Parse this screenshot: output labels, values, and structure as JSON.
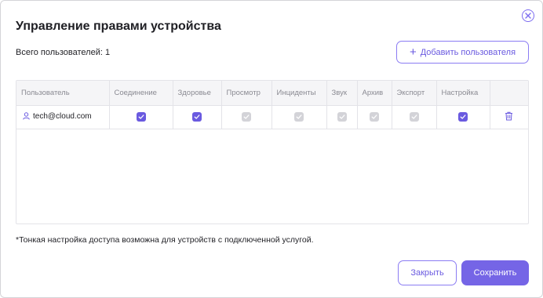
{
  "dialog": {
    "title": "Управление правами устройства",
    "total_users": "Всего пользователей: 1",
    "add_user_label": "Добавить пользователя",
    "footnote": "*Тонкая настройка доступа возможна для устройств с подключенной услугой.",
    "close_label": "Закрыть",
    "save_label": "Сохранить"
  },
  "table": {
    "headers": [
      "Пользователь",
      "Соединение",
      "Здоровье",
      "Просмотр",
      "Инциденты",
      "Звук",
      "Архив",
      "Экспорт",
      "Настройка"
    ],
    "rows": [
      {
        "user": "tech@cloud.com",
        "permissions": [
          true,
          true,
          false,
          false,
          false,
          false,
          false,
          true
        ]
      }
    ]
  },
  "colors": {
    "accent": "#6a5ae0",
    "checkbox_on": "#6a5ae0",
    "checkbox_off": "#d3d3d8",
    "border": "#e3e3e8"
  },
  "icons": {
    "close": "close-circle-icon",
    "add": "plus-icon",
    "user": "user-icon",
    "delete": "trash-icon"
  }
}
